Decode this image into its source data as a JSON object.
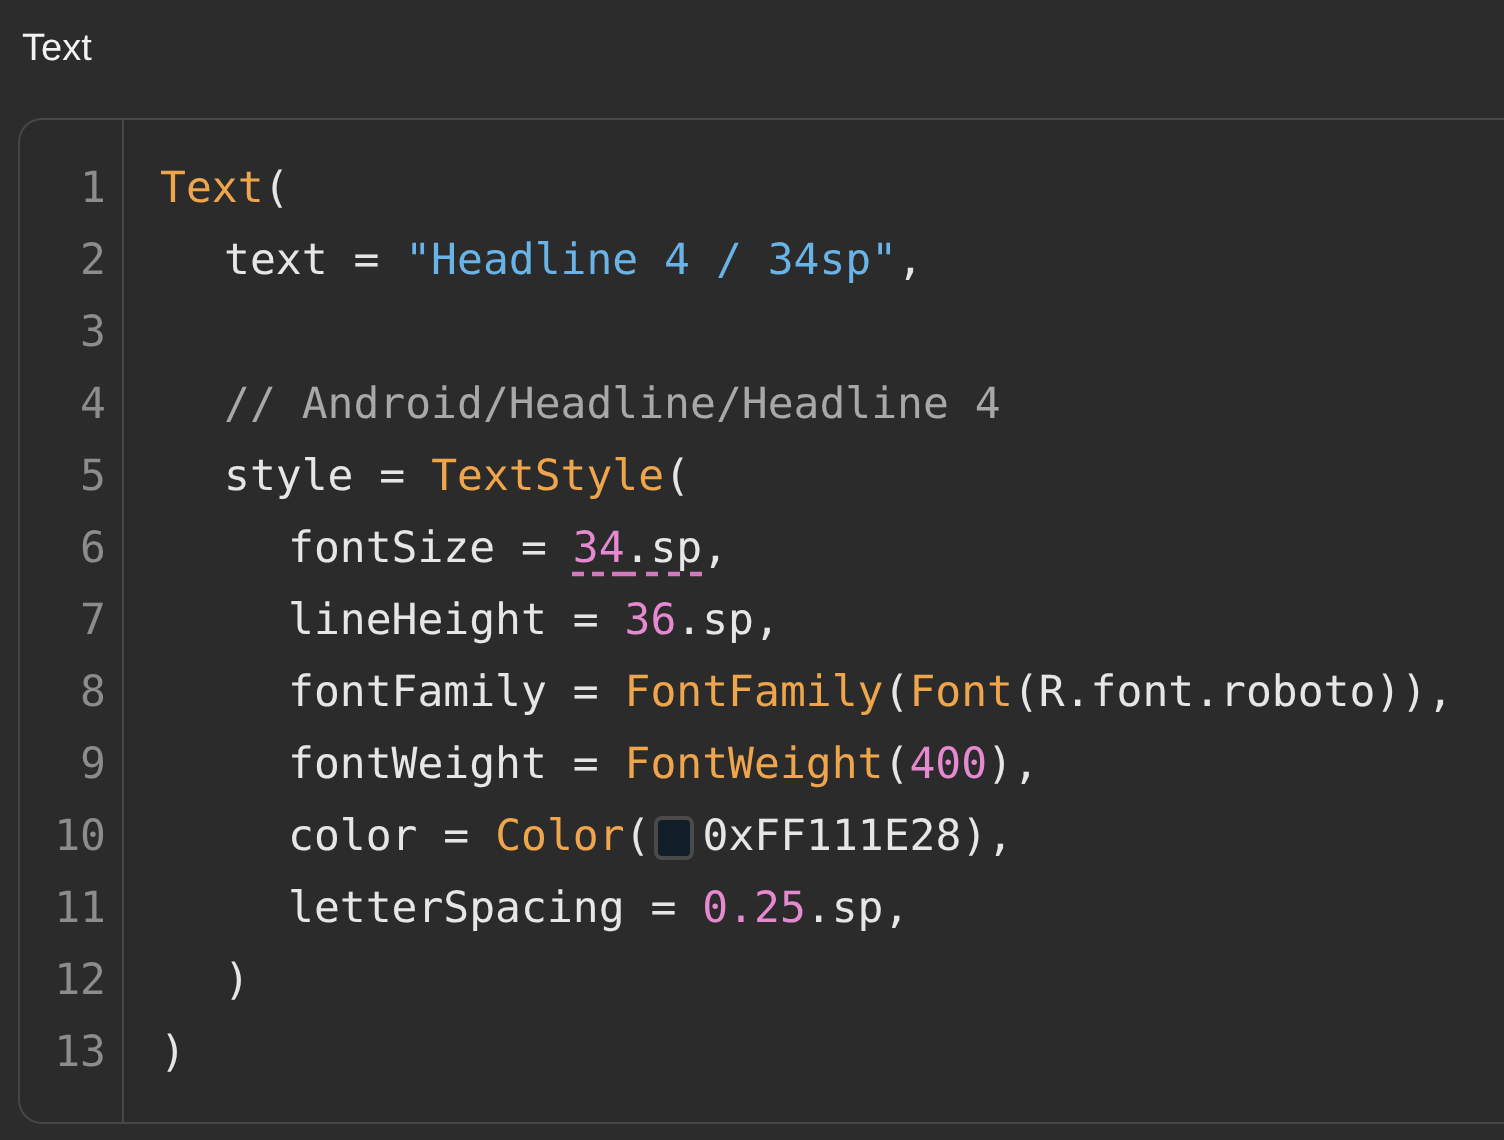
{
  "title": "Text",
  "code": {
    "lines": [
      {
        "number": "1",
        "tokens": [
          {
            "kind": "function",
            "text": "Text"
          },
          {
            "kind": "plain",
            "text": "("
          }
        ],
        "children": [
          {
            "number": "2",
            "tokens": [
              {
                "kind": "plain",
                "text": "text = "
              },
              {
                "kind": "string",
                "text": "\"Headline 4 / 34sp\""
              },
              {
                "kind": "plain",
                "text": ","
              }
            ]
          },
          {
            "number": "3"
          },
          {
            "number": "4",
            "tokens": [
              {
                "kind": "comment",
                "text": "// Android/Headline/Headline 4"
              }
            ]
          },
          {
            "number": "5",
            "tokens": [
              {
                "kind": "plain",
                "text": "style = "
              },
              {
                "kind": "function",
                "text": "TextStyle"
              },
              {
                "kind": "plain",
                "text": "("
              }
            ],
            "children": [
              {
                "number": "6",
                "tokens": [
                  {
                    "kind": "plain",
                    "text": "fontSize = "
                  },
                  {
                    "kind": "number",
                    "text": "34",
                    "warning": true
                  },
                  {
                    "kind": "plain",
                    "text": ".sp",
                    "warning": true
                  },
                  {
                    "kind": "plain",
                    "text": ","
                  }
                ]
              },
              {
                "number": "7",
                "tokens": [
                  {
                    "kind": "plain",
                    "text": "lineHeight = "
                  },
                  {
                    "kind": "number",
                    "text": "36"
                  },
                  {
                    "kind": "plain",
                    "text": ".sp,"
                  }
                ]
              },
              {
                "number": "8",
                "tokens": [
                  {
                    "kind": "plain",
                    "text": "fontFamily = "
                  },
                  {
                    "kind": "function",
                    "text": "FontFamily"
                  },
                  {
                    "kind": "plain",
                    "text": "("
                  },
                  {
                    "kind": "function",
                    "text": "Font"
                  },
                  {
                    "kind": "plain",
                    "text": "(R.font.roboto)),"
                  }
                ]
              },
              {
                "number": "9",
                "tokens": [
                  {
                    "kind": "plain",
                    "text": "fontWeight = "
                  },
                  {
                    "kind": "function",
                    "text": "FontWeight"
                  },
                  {
                    "kind": "plain",
                    "text": "("
                  },
                  {
                    "kind": "number",
                    "text": "400"
                  },
                  {
                    "kind": "plain",
                    "text": "),"
                  }
                ]
              },
              {
                "number": "10",
                "tokens": [
                  {
                    "kind": "plain",
                    "text": "color = "
                  },
                  {
                    "kind": "function",
                    "text": "Color"
                  },
                  {
                    "kind": "plain",
                    "text": "("
                  },
                  {
                    "kind": "swatch",
                    "color": "#111e28"
                  },
                  {
                    "kind": "plain",
                    "text": "0xFF111E28),"
                  }
                ]
              },
              {
                "number": "11",
                "tokens": [
                  {
                    "kind": "plain",
                    "text": "letterSpacing = "
                  },
                  {
                    "kind": "number",
                    "text": "0.25"
                  },
                  {
                    "kind": "plain",
                    "text": ".sp,"
                  }
                ]
              }
            ]
          },
          {
            "number": "12",
            "tokens": [
              {
                "kind": "plain",
                "text": ")"
              }
            ]
          }
        ]
      },
      {
        "number": "13",
        "tokens": [
          {
            "kind": "plain",
            "text": ")"
          }
        ]
      }
    ]
  }
}
